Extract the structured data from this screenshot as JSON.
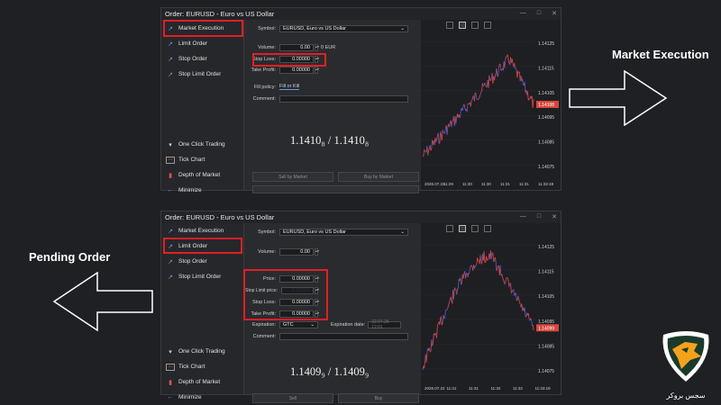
{
  "window_controls": [
    "—",
    "□",
    "✕"
  ],
  "top": {
    "title": "Order: EURUSD - Euro vs US Dollar",
    "sidebar": [
      "Market Execution",
      "Limit Order",
      "Stop Order",
      "Stop Limit Order"
    ],
    "sidebar_bottom": [
      "One Click Trading",
      "Tick Chart",
      "Depth of Market",
      "Minimize"
    ],
    "symbol_label": "Symbol:",
    "symbol_value": "EURUSD, Euro vs US Dollar",
    "volume_label": "Volume:",
    "volume_value": "0.00",
    "volume_unit": "0 EUR",
    "stoploss_label": "Stop Loss:",
    "stoploss_value": "0.00000",
    "takeprofit_label": "Take Profit:",
    "takeprofit_value": "0.00000",
    "fill_label": "Fill policy:",
    "fill_value": "Fill or Kill",
    "comment_label": "Comment:",
    "price_text": "1.1410₈ / 1.1410₈",
    "sell_label": "Sell by Market",
    "buy_label": "Buy by Market",
    "y_ticks": [
      "1.14125",
      "1.14115",
      "1.14105",
      "1.14095",
      "1.14085",
      "1.14075"
    ],
    "x_ticks": [
      "2026.07.22",
      "11:29",
      "11:30",
      "11:30",
      "11:31",
      "11:31",
      "11:32:48"
    ],
    "current_price": "1.14108"
  },
  "bottom": {
    "title": "Order: EURUSD - Euro vs US Dollar",
    "sidebar": [
      "Market Execution",
      "Limit Order",
      "Stop Order",
      "Stop Limit Order"
    ],
    "sidebar_bottom": [
      "One Click Trading",
      "Tick Chart",
      "Depth of Market",
      "Minimize"
    ],
    "symbol_label": "Symbol:",
    "symbol_value": "EURUSD, Euro vs US Dollar",
    "volume_label": "Volume:",
    "volume_value": "0.00",
    "price_label": "Price:",
    "price_value": "0.00000",
    "stoplimit_label": "Stop Limit price:",
    "stoplimit_value": "0.00000",
    "stoploss_label": "Stop Loss:",
    "stoploss_value": "0.00000",
    "takeprofit_label": "Take Profit:",
    "takeprofit_value": "0.00000",
    "expiration_label": "Expiration:",
    "expiration_value": "GTC",
    "expdate_label": "Expiration date:",
    "expdate_value": "22.07.26 12:01",
    "comment_label": "Comment:",
    "price_text": "1.1409₉ / 1.1409₉",
    "sell_label": "Sell",
    "buy_label": "Buy",
    "y_ticks": [
      "1.14125",
      "1.14115",
      "1.14105",
      "1.14095",
      "1.14085",
      "1.14075"
    ],
    "x_ticks": [
      "2026.07.22",
      "11:31",
      "11:31",
      "11:32",
      "11:32",
      "11:33:19"
    ],
    "current_price": "1.14099"
  },
  "annotations": {
    "market_execution": "Market Execution",
    "pending_order": "Pending Order"
  },
  "logo": {
    "caption": "سجس بروکر",
    "brand_color": "#f5a21b"
  }
}
